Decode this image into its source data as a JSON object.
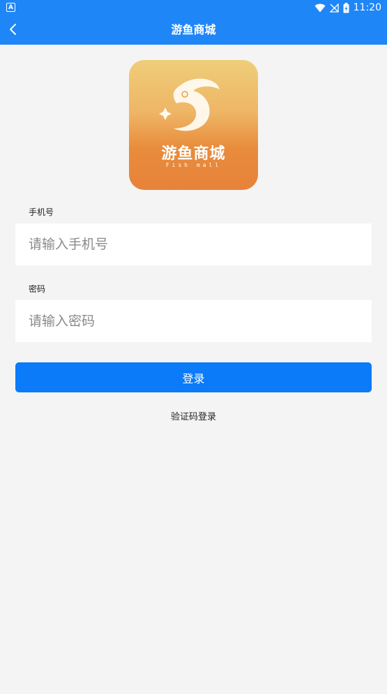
{
  "status_bar": {
    "app_icon_letter": "A",
    "time": "11:20",
    "icons": [
      "wifi-icon",
      "no-signal-icon",
      "battery-icon"
    ]
  },
  "nav": {
    "title": "游鱼商城",
    "back_icon": "chevron-left-icon"
  },
  "logo": {
    "cn_text": "游鱼商城",
    "en_text": "Fish mall"
  },
  "form": {
    "phone": {
      "label": "手机号",
      "placeholder": "请输入手机号",
      "value": ""
    },
    "password": {
      "label": "密码",
      "placeholder": "请输入密码",
      "value": ""
    },
    "login_button_label": "登录",
    "sms_login_label": "验证码登录"
  },
  "colors": {
    "nav_background": "#1f86f8",
    "primary_button": "#0b7bfa",
    "page_background": "#f4f4f4",
    "logo_gradient_top": "#efcd79",
    "logo_gradient_bottom": "#e8823a"
  }
}
